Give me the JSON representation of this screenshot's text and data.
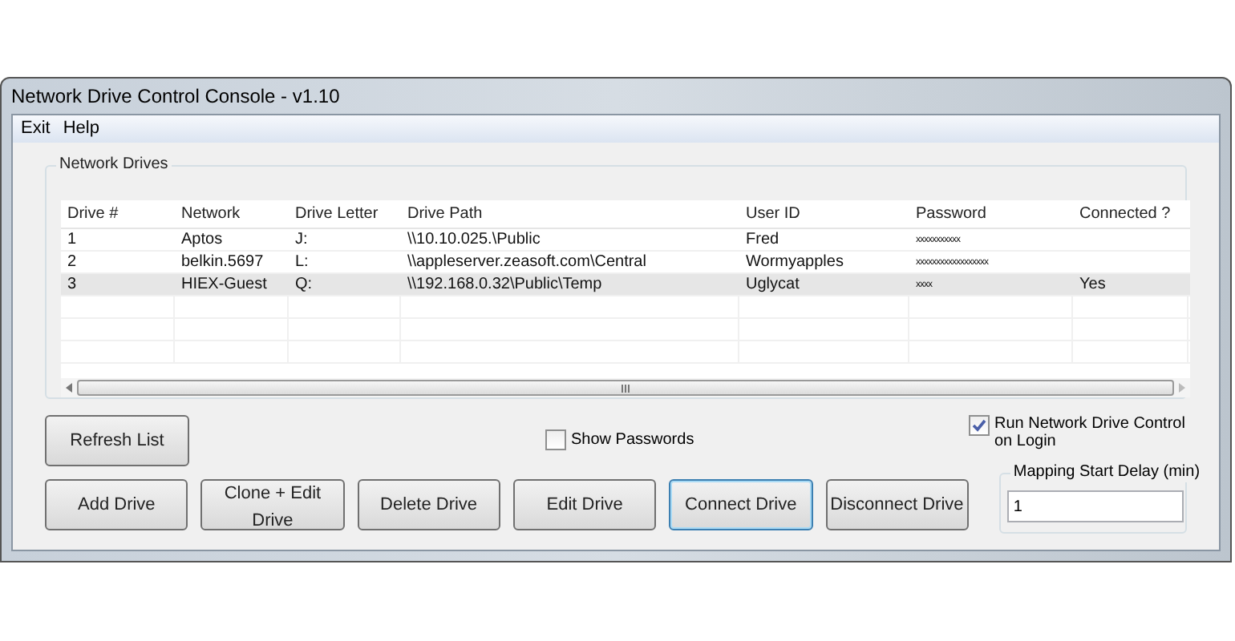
{
  "window": {
    "title": "Network Drive Control Console - v1.10"
  },
  "menu": [
    "Exit",
    "Help"
  ],
  "group": {
    "title": "Network Drives"
  },
  "table": {
    "columns": [
      "Drive #",
      "Network",
      "Drive Letter",
      "Drive Path",
      "User ID",
      "Password",
      "Connected ?"
    ],
    "rows": [
      {
        "selected": false,
        "cells": [
          "1",
          "Aptos",
          "J:",
          "\\\\10.10.025.\\Public",
          "Fred",
          "xxxxxxxxxxx",
          ""
        ]
      },
      {
        "selected": false,
        "cells": [
          "2",
          "belkin.5697",
          "L:",
          "\\\\appleserver.zeasoft.com\\Central",
          "Wormyapples",
          "xxxxxxxxxxxxxxxxxx",
          ""
        ]
      },
      {
        "selected": true,
        "cells": [
          "3",
          "HIEX-Guest",
          "Q:",
          "\\\\192.168.0.32\\Public\\Temp",
          "Uglycat",
          "xxxx",
          "Yes"
        ]
      }
    ]
  },
  "refresh_button": {
    "label": "Refresh List"
  },
  "show_passwords": {
    "label": "Show Passwords",
    "checked": false
  },
  "run_on_login": {
    "label": "Run Network Drive Control on Login",
    "checked": true
  },
  "buttons": [
    {
      "label": "Add Drive",
      "focused": false
    },
    {
      "label": "Clone + Edit Drive",
      "focused": false
    },
    {
      "label": "Delete Drive",
      "focused": false
    },
    {
      "label": "Edit Drive",
      "focused": false
    },
    {
      "label": "Connect Drive",
      "focused": true
    },
    {
      "label": "Disconnect Drive",
      "focused": false
    }
  ],
  "delay": {
    "label": "Mapping Start Delay (min)",
    "value": "1"
  }
}
